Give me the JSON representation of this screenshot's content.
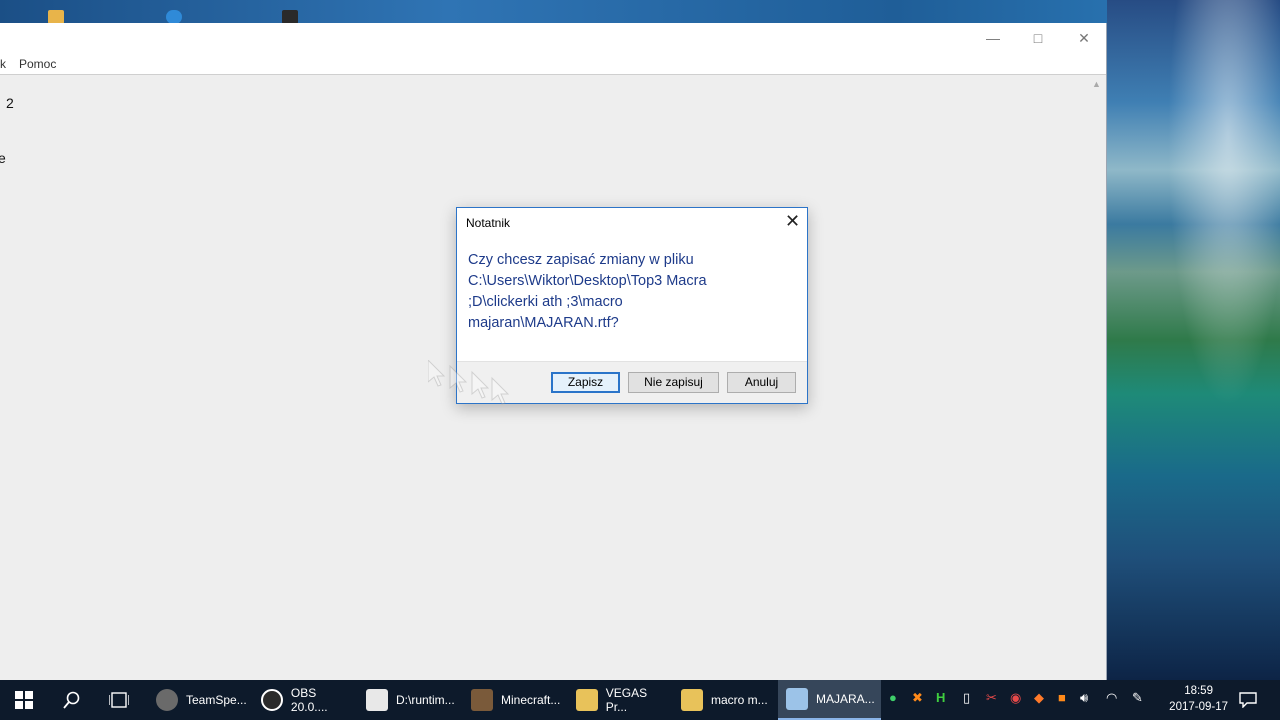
{
  "desktop": {
    "icons": [
      "folder-icon",
      "edge-icon",
      "app-icon"
    ]
  },
  "notepad": {
    "menu": {
      "partial_item": "k",
      "help": "Pomoc"
    },
    "window_controls": {
      "minimize": "—",
      "maximize": "□",
      "close": "✕"
    },
    "document_lines": [
      "2",
      "e"
    ]
  },
  "dialog": {
    "title": "Notatnik",
    "close": "✕",
    "message": "Czy chcesz zapisać zmiany w pliku\nC:\\Users\\Wiktor\\Desktop\\Top3 Macra\n;D\\clickerki ath ;3\\macro\nmajaran\\MAJARAN.rtf?",
    "buttons": {
      "save": "Zapisz",
      "dont_save": "Nie zapisuj",
      "cancel": "Anuluj"
    }
  },
  "taskbar": {
    "apps": [
      {
        "label": "TeamSpe...",
        "icon": "teamspeak-icon",
        "color": "#6a6a6a"
      },
      {
        "label": "OBS 20.0....",
        "icon": "obs-icon",
        "color": "#2b2b2b"
      },
      {
        "label": "D:\\runtim...",
        "icon": "java-icon",
        "color": "#e8e8e8"
      },
      {
        "label": "Minecraft...",
        "icon": "minecraft-icon",
        "color": "#7a5a3a"
      },
      {
        "label": "VEGAS Pr...",
        "icon": "folder-icon",
        "color": "#e8c25a"
      },
      {
        "label": "macro m...",
        "icon": "folder-icon",
        "color": "#e8c25a"
      },
      {
        "label": "MAJARA...",
        "icon": "notepad-icon",
        "color": "#9cc3e8"
      }
    ],
    "clock": {
      "time": "18:59",
      "date": "2017-09-17"
    }
  }
}
